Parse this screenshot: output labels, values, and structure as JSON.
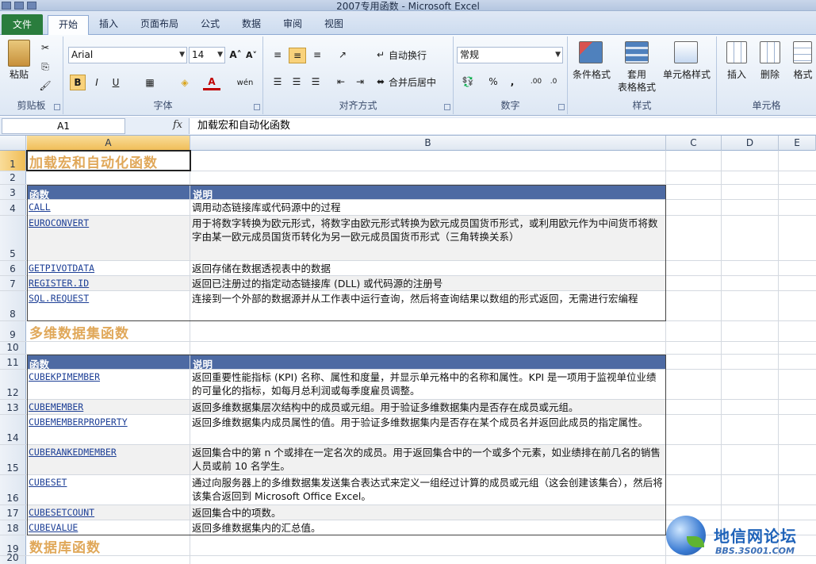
{
  "window": {
    "title": "2007专用函数 - Microsoft Excel"
  },
  "tabs": [
    "文件",
    "开始",
    "插入",
    "页面布局",
    "公式",
    "数据",
    "审阅",
    "视图"
  ],
  "ribbon": {
    "clipboard": {
      "paste": "粘贴",
      "label": "剪贴板"
    },
    "font": {
      "name": "Arial",
      "size": "14",
      "label": "字体"
    },
    "alignment": {
      "wrap": "自动换行",
      "merge": "合并后居中",
      "label": "对齐方式"
    },
    "number": {
      "format": "常规",
      "label": "数字"
    },
    "styles": {
      "conditional": "条件格式",
      "table": "套用\n表格格式",
      "cell": "单元格样式",
      "label": "样式"
    },
    "cells": {
      "insert": "插入",
      "delete": "删除",
      "format": "格式",
      "label": "单元格"
    }
  },
  "formula_bar": {
    "name_box": "A1",
    "fx": "fx",
    "content": "加载宏和自动化函数"
  },
  "columns": [
    "A",
    "B",
    "C",
    "D",
    "E"
  ],
  "rows": {
    "r1": {
      "num": "1",
      "a": "加载宏和自动化函数"
    },
    "r2": {
      "num": "2"
    },
    "r3": {
      "num": "3",
      "a": "函数",
      "b": "说明"
    },
    "r4": {
      "num": "4",
      "a": "CALL",
      "b": "调用动态链接库或代码源中的过程"
    },
    "r5": {
      "num": "5",
      "a": "EUROCONVERT",
      "b": "用于将数字转换为欧元形式，将数字由欧元形式转换为欧元成员国货币形式，或利用欧元作为中间货币将数字由某一欧元成员国货币转化为另一欧元成员国货币形式（三角转换关系）"
    },
    "r6": {
      "num": "6",
      "a": "GETPIVOTDATA",
      "b": "返回存储在数据透视表中的数据"
    },
    "r7": {
      "num": "7",
      "a": "REGISTER.ID",
      "b": "返回已注册过的指定动态链接库 (DLL) 或代码源的注册号"
    },
    "r8": {
      "num": "8",
      "a": "SQL.REQUEST",
      "b": "连接到一个外部的数据源并从工作表中运行查询，然后将查询结果以数组的形式返回，无需进行宏编程"
    },
    "r9": {
      "num": "9",
      "a": "多维数据集函数"
    },
    "r10": {
      "num": "10"
    },
    "r11": {
      "num": "11",
      "a": "函数",
      "b": "说明"
    },
    "r12": {
      "num": "12",
      "a": "CUBEKPIMEMBER",
      "b": "返回重要性能指标 (KPI) 名称、属性和度量，并显示单元格中的名称和属性。KPI 是一项用于监视单位业绩的可量化的指标，如每月总利润或每季度雇员调整。"
    },
    "r13": {
      "num": "13",
      "a": "CUBEMEMBER",
      "b": "返回多维数据集层次结构中的成员或元组。用于验证多维数据集内是否存在成员或元组。"
    },
    "r14": {
      "num": "14",
      "a": "CUBEMEMBERPROPERTY",
      "b": "返回多维数据集内成员属性的值。用于验证多维数据集内是否存在某个成员名并返回此成员的指定属性。"
    },
    "r15": {
      "num": "15",
      "a": "CUBERANKEDMEMBER",
      "b": "返回集合中的第 n 个或排在一定名次的成员。用于返回集合中的一个或多个元素，如业绩排在前几名的销售人员或前 10 名学生。"
    },
    "r16": {
      "num": "16",
      "a": "CUBESET",
      "b": "通过向服务器上的多维数据集发送集合表达式来定义一组经过计算的成员或元组（这会创建该集合），然后将该集合返回到 Microsoft Office Excel。"
    },
    "r17": {
      "num": "17",
      "a": "CUBESETCOUNT",
      "b": "返回集合中的项数。"
    },
    "r18": {
      "num": "18",
      "a": "CUBEVALUE",
      "b": "返回多维数据集内的汇总值。"
    },
    "r19": {
      "num": "19",
      "a": "数据库函数"
    },
    "r20": {
      "num": "20"
    }
  },
  "watermark": {
    "title": "地信网论坛",
    "url": "BBS.3S001.COM"
  }
}
